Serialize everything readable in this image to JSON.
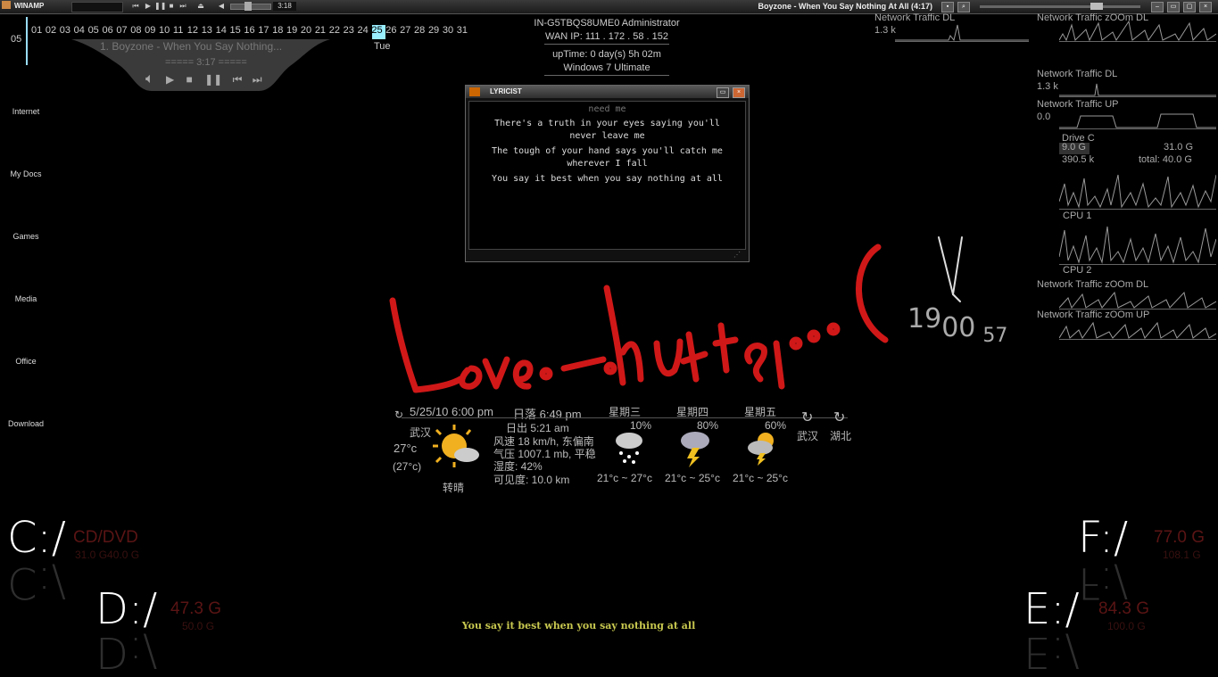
{
  "winamp": {
    "app_name": "WINAMP",
    "time": "3:18",
    "song_title": "Boyzone - When You Say Nothing At All (4:17)"
  },
  "calendar": {
    "month": "05",
    "days": [
      "01",
      "02",
      "03",
      "04",
      "05",
      "06",
      "07",
      "08",
      "09",
      "10",
      "11",
      "12",
      "13",
      "14",
      "15",
      "16",
      "17",
      "18",
      "19",
      "20",
      "21",
      "22",
      "23",
      "24",
      "25",
      "26",
      "27",
      "28",
      "29",
      "30",
      "31"
    ],
    "today": "25",
    "weekday": "Tue"
  },
  "mini_player": {
    "track": "1. Boyzone - When You Say Nothing...",
    "time": "===== 3:17 ====="
  },
  "system": {
    "host_user": "IN-G5TBQS8UME0  Administrator",
    "wan_ip": "WAN IP: 111 . 172 . 58 . 152",
    "uptime": "upTime: 0 day(s) 5h 02m",
    "os": "Windows 7 Ultimate"
  },
  "menu": [
    "Internet",
    "My Docs",
    "Games",
    "Media",
    "Office",
    "Download"
  ],
  "graphs": {
    "net_dl_top": "Network Traffic DL",
    "net_dl_top_value": "1.3 k",
    "net_zoom_dl_top": "Network Traffic zOOm DL",
    "net_dl": "Network Traffic DL",
    "net_dl_value": "1.3 k",
    "net_up": "Network Traffic UP",
    "net_up_value": "0.0",
    "drive_c": "Drive C",
    "drive_c_used": "9.0 G",
    "drive_c_free": "31.0 G",
    "drive_c_speed": "390.5 k",
    "drive_c_total": "total: 40.0 G",
    "cpu1": "CPU 1",
    "cpu2": "CPU 2",
    "net_zoom_dl": "Network Traffic zOOm DL",
    "net_zoom_up": "Network Traffic zOOm UP"
  },
  "lyricist": {
    "title": "LYRICIST",
    "lines": [
      "need me",
      "There's a truth in your eyes saying you'll",
      "never leave me",
      "The tough of your hand says you'll catch me",
      "wherever I fall",
      "You say it best  when you say nothing at all"
    ]
  },
  "clock": {
    "hour": "19",
    "minute": "00",
    "second": "57"
  },
  "weather": {
    "date_time": "5/25/10 6:00 pm",
    "sunset": "日落 6:49 pm",
    "city": "武汉",
    "temp": "27°c",
    "feels": "(27°c)",
    "condition": "转晴",
    "sunrise": "日出 5:21 am",
    "wind": "风速 18 km/h, 东偏南",
    "pressure": "气压 1007.1 mb, 平稳",
    "humidity": "湿度: 42%",
    "visibility": "可见度: 10.0 km",
    "forecast": [
      {
        "day": "星期三",
        "chance": "10%",
        "range": "21°c ~ 27°c"
      },
      {
        "day": "星期四",
        "chance": "80%",
        "range": "21°c ~ 25°c"
      },
      {
        "day": "星期五",
        "chance": "60%",
        "range": "21°c ~ 25°c"
      }
    ],
    "city2": "武汉",
    "province": "湖北"
  },
  "drives": {
    "c": {
      "letter": "C:/",
      "free": "CD/DVD",
      "total": "31.0 G40.0 G"
    },
    "d": {
      "letter": "D:/",
      "free": "47.3 G",
      "total": "50.0 G"
    },
    "f": {
      "letter": "F:/",
      "free": "77.0 G",
      "total": "108.1 G"
    },
    "e": {
      "letter": "E:/",
      "free": "84.3 G",
      "total": "100.0 G"
    }
  },
  "bottom_lyric": "You say it best  when you say nothing at all",
  "colors": {
    "accent": "#99ddff",
    "lyric_yellow": "#c8c850",
    "love_red": "#d01818"
  }
}
